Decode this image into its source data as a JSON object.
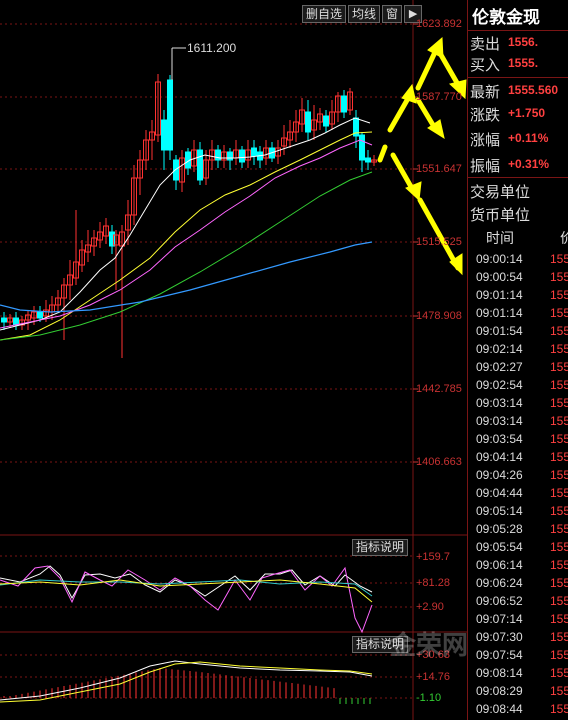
{
  "toolbar": {
    "delete_watch": "删自选",
    "ma_line": "均线",
    "window": "窗"
  },
  "toolbar_arrow_icon": "play-right-icon",
  "main_chart": {
    "high_annotation": "1611.200",
    "price_axis": [
      "1623.892",
      "1587.770",
      "1551.647",
      "1515.525",
      "1478.908",
      "1442.785",
      "1406.663"
    ]
  },
  "indicator1": {
    "button": "指标说明",
    "axis": [
      "+159.7",
      "+81.28",
      "+2.90"
    ]
  },
  "indicator2": {
    "button": "指标说明",
    "axis": [
      "+30.63",
      "+14.76",
      "-1.10"
    ]
  },
  "panel": {
    "title": "伦敦金现",
    "quote": [
      {
        "label": "卖出",
        "value": "1556."
      },
      {
        "label": "买入",
        "value": "1555."
      },
      {
        "label": "最新",
        "value": "1555.560"
      },
      {
        "label": "涨跌",
        "value": "+1.750"
      },
      {
        "label": "涨幅",
        "value": "+0.11%"
      },
      {
        "label": "振幅",
        "value": "+0.31%"
      }
    ],
    "info": [
      {
        "label": "交易单位"
      },
      {
        "label": "货币单位"
      }
    ],
    "table_headers": {
      "time": "时间",
      "price": "价"
    },
    "ticks": [
      {
        "time": "09:00:14",
        "price": "155"
      },
      {
        "time": "09:00:54",
        "price": "155"
      },
      {
        "time": "09:01:14",
        "price": "155"
      },
      {
        "time": "09:01:14",
        "price": "155"
      },
      {
        "time": "09:01:54",
        "price": "155"
      },
      {
        "time": "09:02:14",
        "price": "155"
      },
      {
        "time": "09:02:27",
        "price": "155"
      },
      {
        "time": "09:02:54",
        "price": "155"
      },
      {
        "time": "09:03:14",
        "price": "155"
      },
      {
        "time": "09:03:14",
        "price": "155"
      },
      {
        "time": "09:03:54",
        "price": "155"
      },
      {
        "time": "09:04:14",
        "price": "155"
      },
      {
        "time": "09:04:26",
        "price": "155"
      },
      {
        "time": "09:04:44",
        "price": "155"
      },
      {
        "time": "09:05:14",
        "price": "155"
      },
      {
        "time": "09:05:28",
        "price": "155"
      },
      {
        "time": "09:05:54",
        "price": "155"
      },
      {
        "time": "09:06:14",
        "price": "155"
      },
      {
        "time": "09:06:24",
        "price": "155"
      },
      {
        "time": "09:06:52",
        "price": "155"
      },
      {
        "time": "09:07:14",
        "price": "155"
      },
      {
        "time": "09:07:30",
        "price": "155"
      },
      {
        "time": "09:07:54",
        "price": "155"
      },
      {
        "time": "09:08:14",
        "price": "155"
      },
      {
        "time": "09:08:29",
        "price": "155"
      },
      {
        "time": "09:08:44",
        "price": "155"
      }
    ]
  },
  "watermark": "金荣网",
  "colors": {
    "up": "#ff3232",
    "down": "#00ffff",
    "grid": "#7a1515",
    "arrow": "#ffff00"
  }
}
